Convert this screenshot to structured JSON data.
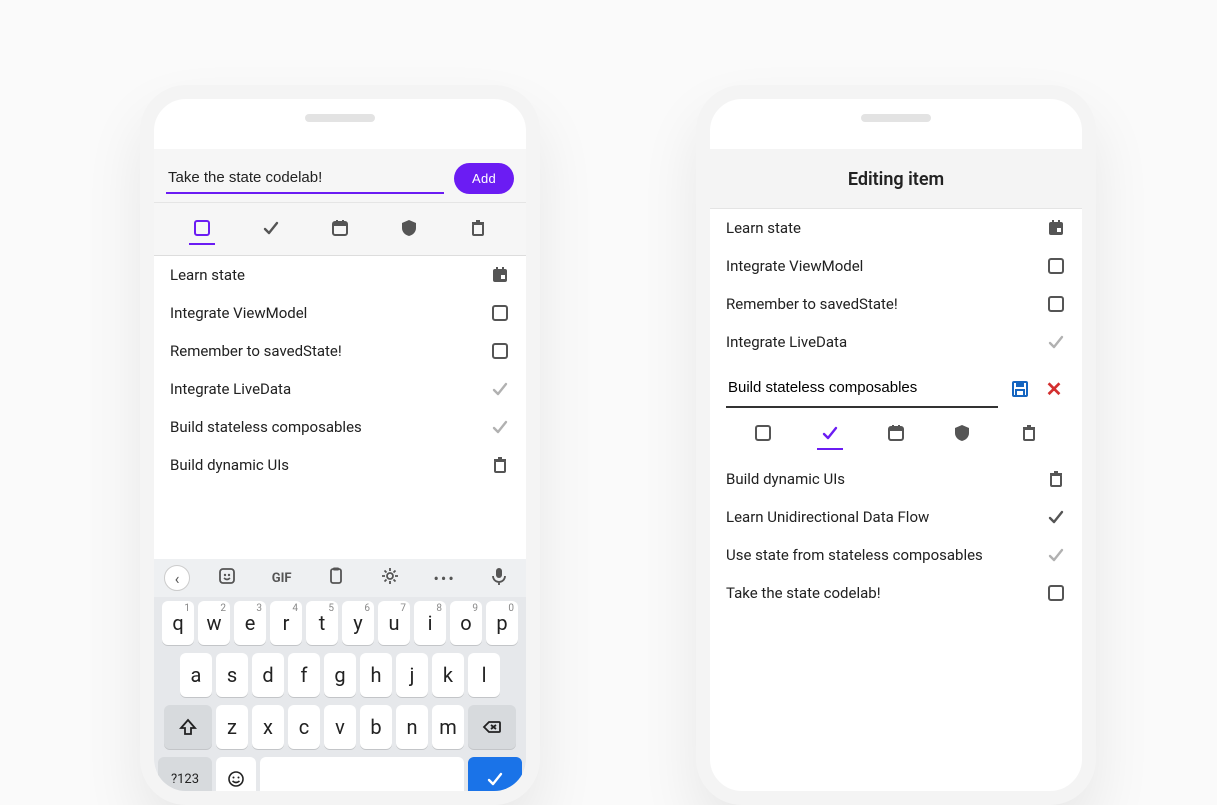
{
  "left": {
    "input_value": "Take the state codelab!",
    "add_label": "Add",
    "icons": [
      "square",
      "check",
      "calendar",
      "shield",
      "trash"
    ],
    "active_icon": 0,
    "items": [
      {
        "label": "Learn state",
        "icon": "calendar-filled"
      },
      {
        "label": "Integrate ViewModel",
        "icon": "square"
      },
      {
        "label": "Remember to savedState!",
        "icon": "square"
      },
      {
        "label": "Integrate LiveData",
        "icon": "check-dim"
      },
      {
        "label": "Build stateless composables",
        "icon": "check-dim"
      },
      {
        "label": "Build dynamic UIs",
        "icon": "trash"
      }
    ],
    "keyboard": {
      "gif_label": "GIF",
      "row1": [
        {
          "k": "q",
          "n": "1"
        },
        {
          "k": "w",
          "n": "2"
        },
        {
          "k": "e",
          "n": "3"
        },
        {
          "k": "r",
          "n": "4"
        },
        {
          "k": "t",
          "n": "5"
        },
        {
          "k": "y",
          "n": "6"
        },
        {
          "k": "u",
          "n": "7"
        },
        {
          "k": "i",
          "n": "8"
        },
        {
          "k": "o",
          "n": "9"
        },
        {
          "k": "p",
          "n": "0"
        }
      ],
      "row2": [
        "a",
        "s",
        "d",
        "f",
        "g",
        "h",
        "j",
        "k",
        "l"
      ],
      "row3": [
        "z",
        "x",
        "c",
        "v",
        "b",
        "n",
        "m"
      ],
      "sym_label": "?123"
    }
  },
  "right": {
    "header": "Editing item",
    "top_items": [
      {
        "label": "Learn state",
        "icon": "calendar-filled"
      },
      {
        "label": "Integrate ViewModel",
        "icon": "square"
      },
      {
        "label": "Remember to savedState!",
        "icon": "square"
      },
      {
        "label": "Integrate LiveData",
        "icon": "check-dim"
      }
    ],
    "edit_value": "Build stateless composables",
    "icons": [
      "square",
      "check",
      "calendar",
      "shield",
      "trash"
    ],
    "active_icon": 1,
    "bottom_items": [
      {
        "label": "Build dynamic UIs",
        "icon": "trash"
      },
      {
        "label": "Learn Unidirectional Data Flow",
        "icon": "check"
      },
      {
        "label": "Use state from stateless composables",
        "icon": "check-dim"
      },
      {
        "label": "Take the state codelab!",
        "icon": "square"
      }
    ]
  }
}
